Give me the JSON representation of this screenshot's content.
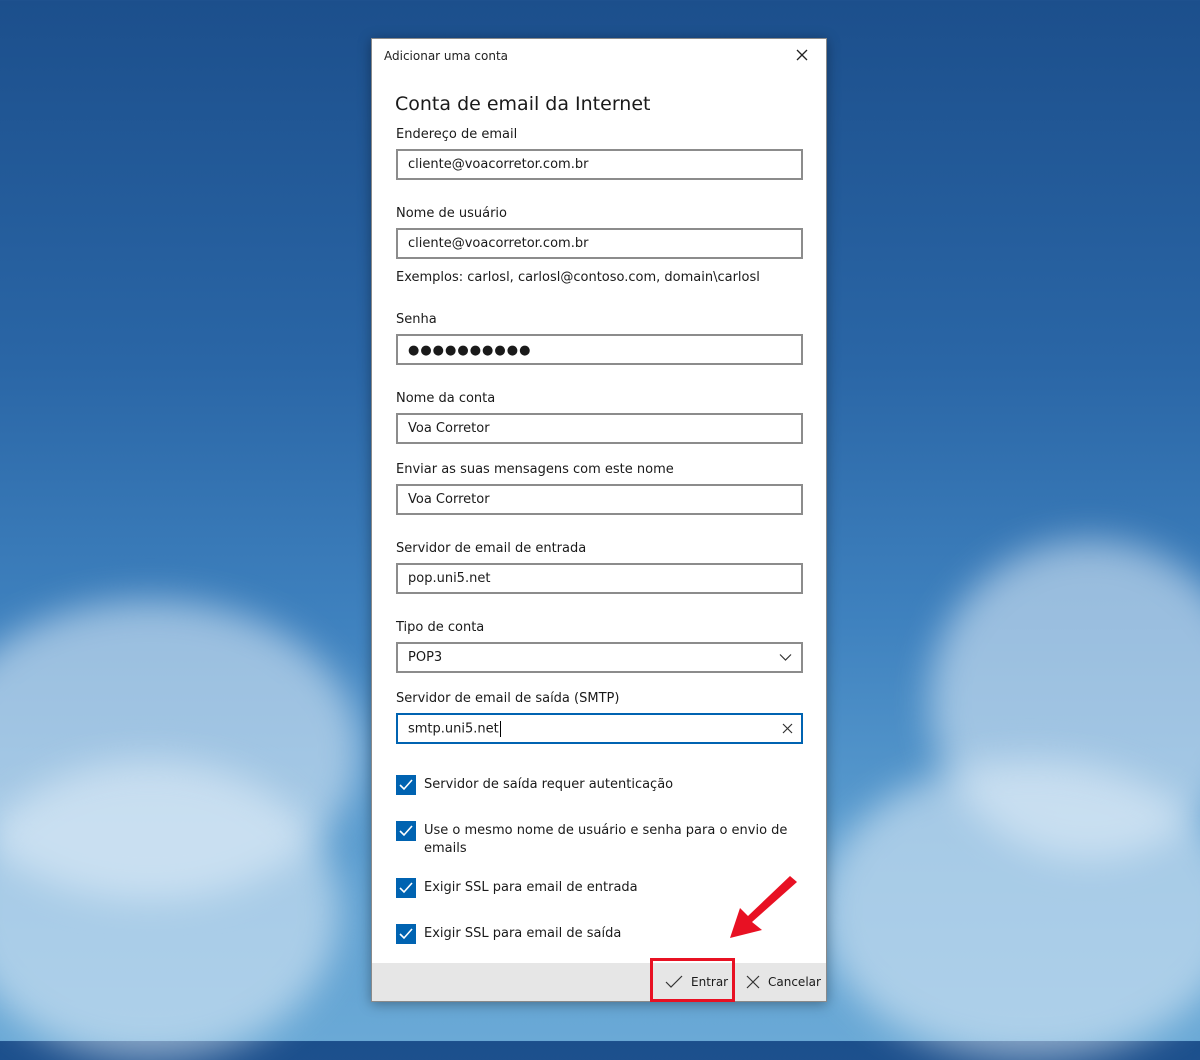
{
  "dialog": {
    "title": "Adicionar uma conta",
    "heading": "Conta de email da Internet"
  },
  "fields": {
    "email": {
      "label": "Endereço de email",
      "value": "cliente@voacorretor.com.br"
    },
    "username": {
      "label": "Nome de usuário",
      "value": "cliente@voacorretor.com.br",
      "hint": "Exemplos: carlosl, carlosl@contoso.com, domain\\carlosl"
    },
    "password": {
      "label": "Senha",
      "value": "●●●●●●●●●●"
    },
    "account_name": {
      "label": "Nome da conta",
      "value": "Voa Corretor"
    },
    "sender_name": {
      "label": "Enviar as suas mensagens com este nome",
      "value": "Voa Corretor"
    },
    "incoming_server": {
      "label": "Servidor de email de entrada",
      "value": "pop.uni5.net"
    },
    "account_type": {
      "label": "Tipo de conta",
      "value": "POP3"
    },
    "outgoing_server": {
      "label": "Servidor de email de saída (SMTP)",
      "value": "smtp.uni5.net"
    }
  },
  "checkboxes": [
    {
      "label": "Servidor de saída requer autenticação",
      "checked": true
    },
    {
      "label": "Use o mesmo nome de usuário e senha para o envio de emails",
      "checked": true
    },
    {
      "label": "Exigir SSL para email de entrada",
      "checked": true
    },
    {
      "label": "Exigir SSL para email de saída",
      "checked": true
    }
  ],
  "footer": {
    "enter_label": "Entrar",
    "cancel_label": "Cancelar"
  },
  "colors": {
    "accent": "#0063b1",
    "highlight": "#e81123"
  }
}
